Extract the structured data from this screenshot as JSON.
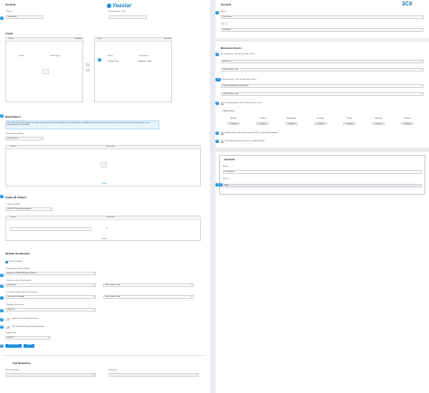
{
  "left": {
    "general": {
      "title": "General",
      "name_label": "* Name",
      "name_value": "Test Route",
      "password_label": "Password For Call",
      "marker": "1"
    },
    "trunk": {
      "title": "Trunk",
      "left_header": "Trunks",
      "left_header_right": "Available",
      "right_header": "Trunk",
      "right_header_right": "Selected",
      "col_name": "Name",
      "col_type": "Trunk Type",
      "selected_name": "Yeastar Test",
      "selected_type": "Register Trunk",
      "marker": "2"
    },
    "dial_pattern": {
      "title": "Dial Pattern",
      "notice": "The number that matches these rules will be compared with the Trunk's Number Format; otherwise the call will fail because the number doesn't match. For more info about this setting, please see the documentation for more details.",
      "label": "* Dial Patterns Mode",
      "value": "Dial Pattern",
      "col_pattern": "Pattern",
      "col_ops": "Operations",
      "add": "+ Add",
      "marker": "3"
    },
    "caller_id": {
      "title": "Caller ID Pattern",
      "label": "* Caller ID Mode",
      "value": "Caller ID Matching Settings",
      "col_pattern": "Pattern",
      "col_ops": "Operations",
      "add": "+ Add",
      "marker": "4"
    },
    "default_dest": {
      "title": "Default Destination",
      "radio_label": "Fixed Condition",
      "matching_label": "* Destination Routing Mode",
      "matching_value": "Based on Global Business Hours",
      "business_label": "* Business Hours Destination",
      "business_value": "Extension",
      "business_ext": "1000 (admin, ext)",
      "after_label": "* Outside Business Hours Destination",
      "after_value": "Unknown Voicemail",
      "after_ext": "1000 (admin, ext)",
      "holiday_label": "* Holiday Destination",
      "holiday_value": "Hang up",
      "option1": "Ignore the Holiday Destination",
      "option2": "Play Holiday Prompt During Holidays",
      "prompt_label": "Prompt Files",
      "prompt_value": "Default",
      "btn_record": "Record New",
      "btn_upload": "Upload",
      "markers": [
        "5",
        "6",
        "7",
        "8",
        "9",
        "10",
        "11"
      ]
    },
    "fax": {
      "title": "Fax Detection",
      "label": "Fax Destination",
      "label2": "Extension"
    }
  },
  "right": {
    "general": {
      "title": "General",
      "name_label": "Name",
      "name_value": "Test Route",
      "did_label": "DID Or",
      "did_value": "Unknown",
      "marker": "1"
    },
    "business_hours": {
      "title": "Business Hours",
      "dest1_label": "Destination for calls during office hours",
      "dest1_value": "Extension",
      "dest1_ext": "1000 (admin, ext)",
      "dest2_label": "Destination for calls outside office hours",
      "dest2_value": "Voicemail/Hang Up Extension",
      "dest2_ext": "1000 (admin, ext)",
      "opt1": "Use group-wide Office Hours for this route",
      "office_hours_title": "Office Hours",
      "days": [
        "Monday",
        "Tuesday",
        "Wednesday",
        "Thursday",
        "Friday",
        "Saturday",
        "Sunday"
      ],
      "chip": "Configure",
      "opt2": "Enable Super Office hours mode (TOFU Light field) Holidays",
      "opt3": "Play Holiday prompt when it's a global holiday",
      "markers": [
        "2",
        "3",
        "4",
        "5",
        "6",
        "7"
      ]
    },
    "general2": {
      "title": "General",
      "name_label": "Name",
      "name_value": "Test Route",
      "did_label": "DID Or",
      "did_value": "Main",
      "markers": [
        "1",
        "2",
        "3"
      ]
    }
  },
  "logo": {
    "text": "Yeastar",
    "brand_right": "3CX"
  },
  "colors": {
    "accent": "#1a8fdd",
    "background": "#e9ebee",
    "panel": "#ffffff"
  }
}
